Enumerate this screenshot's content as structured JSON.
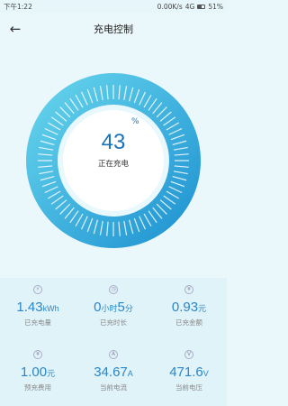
{
  "status_bar": {
    "time": "下午1:22",
    "network": "0.00K/s",
    "signal": "4G",
    "battery": "51%"
  },
  "header": {
    "title": "充电控制"
  },
  "gauge": {
    "value": "43",
    "unit": "%",
    "label": "正在充电",
    "progress": 0.43
  },
  "stats": [
    {
      "value": "1.43",
      "unit": "kWh",
      "label": "已充电量",
      "icon": "lightning-icon"
    },
    {
      "value": "0",
      "unit": "小时",
      "value2": "5",
      "unit2": "分",
      "label": "已充时长",
      "icon": "clock-icon"
    },
    {
      "value": "0.93",
      "unit": "元",
      "label": "已充金额",
      "icon": "yuan-icon"
    },
    {
      "value": "1.00",
      "unit": "元",
      "label": "预充费用",
      "icon": "yuan-icon"
    },
    {
      "value": "34.67",
      "unit": "A",
      "label": "当前电流",
      "icon": "current-icon"
    },
    {
      "value": "471.6",
      "unit": "V",
      "label": "当前电压",
      "icon": "voltage-icon"
    }
  ],
  "colors": {
    "accent": "#1a73b8",
    "ring_light": "#5fd0ea",
    "ring_dark": "#1b9ad6"
  }
}
